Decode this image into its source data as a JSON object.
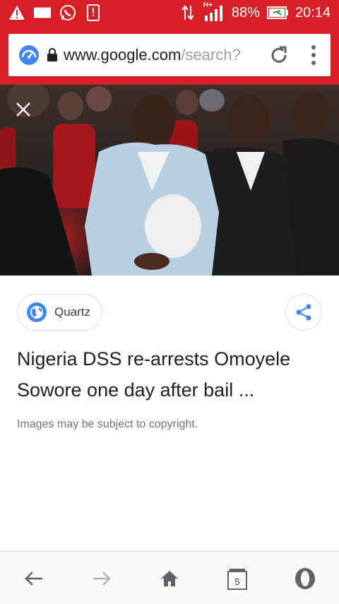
{
  "status_bar": {
    "battery": "88%",
    "time": "20:14",
    "network_label": "H+",
    "icons": [
      "warning-icon",
      "notification-icon",
      "whatsapp-icon",
      "sim-icon",
      "data-transfer-icon",
      "signal-icon",
      "battery-icon"
    ]
  },
  "address_bar": {
    "domain": "www.google.com",
    "path": "/search?"
  },
  "result": {
    "source": "Quartz",
    "title": "Nigeria DSS re-arrests Omoyele Sowore one day after bail ...",
    "caption": "Images may be subject to copyright."
  },
  "bottom_nav": {
    "tabs_count": "5",
    "items": [
      "back-icon",
      "forward-icon",
      "home-icon",
      "tabs-icon",
      "opera-icon"
    ]
  },
  "colors": {
    "brand_red": "#d81f26",
    "accent_blue": "#4285f4"
  }
}
